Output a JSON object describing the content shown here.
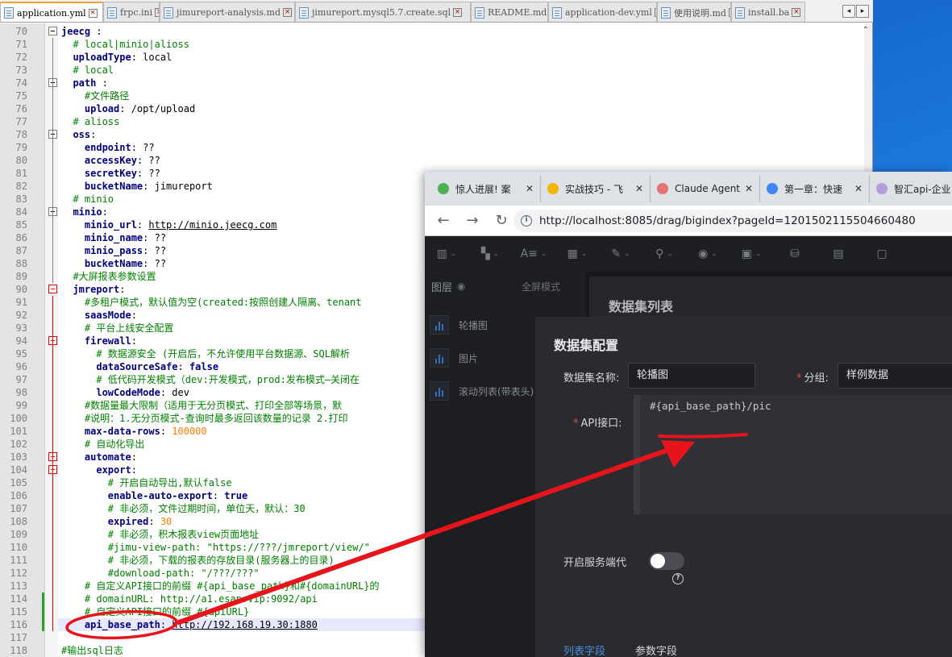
{
  "editor": {
    "tabs": [
      {
        "label": "application.yml",
        "active": true
      },
      {
        "label": "frpc.ini",
        "active": false
      },
      {
        "label": "jimureport-analysis.md",
        "active": false
      },
      {
        "label": "jimureport.mysql5.7.create.sql",
        "active": false
      },
      {
        "label": "README.md",
        "active": false
      },
      {
        "label": "application-dev.yml",
        "active": false
      },
      {
        "label": "使用说明.md",
        "active": false
      },
      {
        "label": "install.ba",
        "active": false
      }
    ],
    "nav_prev": "◂",
    "nav_next": "▸",
    "lines": [
      {
        "n": "70",
        "segs": [
          {
            "t": "jeecg",
            "c": "k"
          },
          {
            "t": " :",
            "c": "v"
          }
        ]
      },
      {
        "n": "71",
        "segs": [
          {
            "t": "  # local|minio|alioss",
            "c": "c"
          }
        ]
      },
      {
        "n": "72",
        "segs": [
          {
            "t": "  uploadType",
            "c": "k"
          },
          {
            "t": ": local",
            "c": "v"
          }
        ]
      },
      {
        "n": "73",
        "segs": [
          {
            "t": "  # local",
            "c": "c"
          }
        ]
      },
      {
        "n": "74",
        "segs": [
          {
            "t": "  path",
            "c": "k"
          },
          {
            "t": " :",
            "c": "v"
          }
        ]
      },
      {
        "n": "75",
        "segs": [
          {
            "t": "    #文件路径",
            "c": "c"
          }
        ]
      },
      {
        "n": "76",
        "segs": [
          {
            "t": "    upload",
            "c": "k"
          },
          {
            "t": ": /opt/upload",
            "c": "v"
          }
        ]
      },
      {
        "n": "77",
        "segs": [
          {
            "t": "  # alioss",
            "c": "c"
          }
        ]
      },
      {
        "n": "78",
        "segs": [
          {
            "t": "  oss",
            "c": "k"
          },
          {
            "t": ":",
            "c": "v"
          }
        ]
      },
      {
        "n": "79",
        "segs": [
          {
            "t": "    endpoint",
            "c": "k"
          },
          {
            "t": ": ??",
            "c": "v"
          }
        ]
      },
      {
        "n": "80",
        "segs": [
          {
            "t": "    accessKey",
            "c": "k"
          },
          {
            "t": ": ??",
            "c": "v"
          }
        ]
      },
      {
        "n": "81",
        "segs": [
          {
            "t": "    secretKey",
            "c": "k"
          },
          {
            "t": ": ??",
            "c": "v"
          }
        ]
      },
      {
        "n": "82",
        "segs": [
          {
            "t": "    bucketName",
            "c": "k"
          },
          {
            "t": ": jimureport",
            "c": "v"
          }
        ]
      },
      {
        "n": "83",
        "segs": [
          {
            "t": "  # minio",
            "c": "c"
          }
        ]
      },
      {
        "n": "84",
        "segs": [
          {
            "t": "  minio",
            "c": "k"
          },
          {
            "t": ":",
            "c": "v"
          }
        ]
      },
      {
        "n": "85",
        "segs": [
          {
            "t": "    minio_url",
            "c": "k"
          },
          {
            "t": ": ",
            "c": "v"
          },
          {
            "t": "http://minio.jeecg.com",
            "c": "u"
          }
        ]
      },
      {
        "n": "86",
        "segs": [
          {
            "t": "    minio_name",
            "c": "k"
          },
          {
            "t": ": ??",
            "c": "v"
          }
        ]
      },
      {
        "n": "87",
        "segs": [
          {
            "t": "    minio_pass",
            "c": "k"
          },
          {
            "t": ": ??",
            "c": "v"
          }
        ]
      },
      {
        "n": "88",
        "segs": [
          {
            "t": "    bucketName",
            "c": "k"
          },
          {
            "t": ": ??",
            "c": "v"
          }
        ]
      },
      {
        "n": "89",
        "segs": [
          {
            "t": "  #大屏报表参数设置",
            "c": "c"
          }
        ]
      },
      {
        "n": "90",
        "segs": [
          {
            "t": "  jmreport",
            "c": "k"
          },
          {
            "t": ":",
            "c": "v"
          }
        ]
      },
      {
        "n": "91",
        "segs": [
          {
            "t": "    #多租户模式，默认值为空(created:按照创建人隔离、tenant",
            "c": "c"
          }
        ]
      },
      {
        "n": "92",
        "segs": [
          {
            "t": "    saasMode",
            "c": "k"
          },
          {
            "t": ":",
            "c": "v"
          }
        ]
      },
      {
        "n": "93",
        "segs": [
          {
            "t": "    # 平台上线安全配置",
            "c": "c"
          }
        ]
      },
      {
        "n": "94",
        "segs": [
          {
            "t": "    firewall",
            "c": "k"
          },
          {
            "t": ":",
            "c": "v"
          }
        ]
      },
      {
        "n": "95",
        "segs": [
          {
            "t": "      # 数据源安全 (开启后，不允许使用平台数据源、SQL解析",
            "c": "c"
          }
        ]
      },
      {
        "n": "96",
        "segs": [
          {
            "t": "      dataSourceSafe",
            "c": "k"
          },
          {
            "t": ": ",
            "c": "v"
          },
          {
            "t": "false",
            "c": "k"
          }
        ]
      },
      {
        "n": "97",
        "segs": [
          {
            "t": "      # 低代码开发模式（dev:开发模式，prod:发布模式—关闭在",
            "c": "c"
          }
        ]
      },
      {
        "n": "98",
        "segs": [
          {
            "t": "      lowCodeMode",
            "c": "k"
          },
          {
            "t": ": dev",
            "c": "v"
          }
        ]
      },
      {
        "n": "99",
        "segs": [
          {
            "t": "    #数据量最大限制（适用于无分页模式、打印全部等场景，默",
            "c": "c"
          }
        ]
      },
      {
        "n": "100",
        "segs": [
          {
            "t": "    #说明：1.无分页模式-查询时最多返回该数量的记录 2.打印",
            "c": "c"
          }
        ]
      },
      {
        "n": "101",
        "segs": [
          {
            "t": "    max-data-rows",
            "c": "k"
          },
          {
            "t": ": ",
            "c": "v"
          },
          {
            "t": "100000",
            "c": "n"
          }
        ]
      },
      {
        "n": "102",
        "segs": [
          {
            "t": "    # 自动化导出",
            "c": "c"
          }
        ]
      },
      {
        "n": "103",
        "segs": [
          {
            "t": "    automate",
            "c": "k"
          },
          {
            "t": ":",
            "c": "v"
          }
        ]
      },
      {
        "n": "104",
        "segs": [
          {
            "t": "      export",
            "c": "k"
          },
          {
            "t": ":",
            "c": "v"
          }
        ]
      },
      {
        "n": "105",
        "segs": [
          {
            "t": "        # 开启自动导出,默认false",
            "c": "c"
          }
        ]
      },
      {
        "n": "106",
        "segs": [
          {
            "t": "        enable-auto-export",
            "c": "k"
          },
          {
            "t": ": ",
            "c": "v"
          },
          {
            "t": "true",
            "c": "k"
          }
        ]
      },
      {
        "n": "107",
        "segs": [
          {
            "t": "        # 非必须，文件过期时间，单位天，默认：30",
            "c": "c"
          }
        ]
      },
      {
        "n": "108",
        "segs": [
          {
            "t": "        expired",
            "c": "k"
          },
          {
            "t": ": ",
            "c": "v"
          },
          {
            "t": "30",
            "c": "n"
          }
        ]
      },
      {
        "n": "109",
        "segs": [
          {
            "t": "        # 非必须，积木报表view页面地址",
            "c": "c"
          }
        ]
      },
      {
        "n": "110",
        "segs": [
          {
            "t": "        #jimu-view-path: \"https://???/jmreport/view/\"",
            "c": "c"
          }
        ]
      },
      {
        "n": "111",
        "segs": [
          {
            "t": "        # 非必须，下载的报表的存放目录(服务器上的目录)",
            "c": "c"
          }
        ]
      },
      {
        "n": "112",
        "segs": [
          {
            "t": "        #download-path: \"/???/???\"",
            "c": "c"
          }
        ]
      },
      {
        "n": "113",
        "segs": [
          {
            "t": "    # 自定义API接口的前缀 #{api_base_path}和#{domainURL}的",
            "c": "c"
          }
        ]
      },
      {
        "n": "114",
        "segs": [
          {
            "t": "    # domainURL: http://a1.esap.vip:9092/api",
            "c": "c"
          }
        ]
      },
      {
        "n": "115",
        "segs": [
          {
            "t": "    # 自定义API接口的前缀 #{apiURL}",
            "c": "c"
          }
        ]
      },
      {
        "n": "116",
        "segs": [
          {
            "t": "    api_base_path",
            "c": "k"
          },
          {
            "t": ": ",
            "c": "v"
          },
          {
            "t": "http://192.168.19.30:1880",
            "c": "u"
          }
        ]
      },
      {
        "n": "117",
        "segs": [
          {
            "t": "",
            "c": "v"
          }
        ]
      },
      {
        "n": "118",
        "segs": [
          {
            "t": "#输出sql日志",
            "c": "c"
          }
        ]
      }
    ]
  },
  "browser": {
    "tabs": [
      {
        "label": "惊人进展! 案",
        "color": "#4caf50"
      },
      {
        "label": "实战技巧 - 飞",
        "color": "#f4b400"
      },
      {
        "label": "Claude Agent",
        "color": "#e57373"
      },
      {
        "label": "第一章：快速",
        "color": "#4285f4"
      },
      {
        "label": "智汇api-企业",
        "color": "#b39ddb"
      }
    ],
    "tab_close": "✕",
    "back": "←",
    "forward": "→",
    "reload": "↻",
    "url": "http://localhost:8085/drag/bigindex?pageId=1201502115504660480",
    "info_glyph": "i"
  },
  "app": {
    "sidebar": {
      "title": "图层",
      "eye": "◉",
      "fullscreen": "全屏模式",
      "items": [
        "轮播图",
        "图片",
        "滚动列表(带表头)"
      ]
    },
    "list_title": "数据集列表",
    "toolbar_icons": [
      "chart-icon",
      "brush-icon",
      "text-icon",
      "table-icon",
      "edit-icon",
      "map-pin-icon",
      "record-icon",
      "grid-icon",
      "database-icon",
      "save-icon",
      "more-icon"
    ],
    "toolbar_glyphs": [
      "▥",
      "▚",
      "A≡",
      "▦",
      "✎",
      "⚲",
      "◉",
      "▣",
      "⛁",
      "▤",
      "▢"
    ],
    "chevron": "⌄"
  },
  "modal": {
    "title": "数据集配置",
    "name_label": "数据集名称:",
    "name_value": "轮播图",
    "group_label": "分组:",
    "group_value": "样例数据",
    "api_label": "API接口:",
    "api_value": "#{api_base_path}/pic",
    "proxy_label": "开启服务端代",
    "help_glyph": "?",
    "required_mark": "*",
    "tab_list_fields": "列表字段",
    "tab_param_fields": "参数字段"
  },
  "colors": {
    "annotation_red": "#e8141c",
    "link_blue": "#4a8fe0"
  }
}
